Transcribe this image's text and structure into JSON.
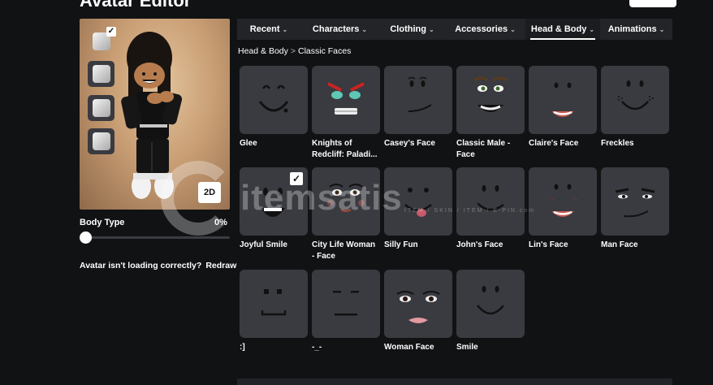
{
  "header": {
    "title": "Avatar Editor"
  },
  "preview": {
    "toggle_label": "2D"
  },
  "body_type": {
    "label": "Body Type",
    "value": "0%",
    "level": 0
  },
  "notice": {
    "text": "Avatar isn't loading correctly?",
    "link": "Redraw"
  },
  "tabs": [
    {
      "label": "Recent",
      "active": false
    },
    {
      "label": "Characters",
      "active": false
    },
    {
      "label": "Clothing",
      "active": false
    },
    {
      "label": "Accessories",
      "active": false
    },
    {
      "label": "Head & Body",
      "active": true
    },
    {
      "label": "Animations",
      "active": false
    }
  ],
  "breadcrumb": {
    "parent": "Head & Body",
    "separator": ">",
    "current": "Classic Faces"
  },
  "faces": [
    {
      "name": "Glee",
      "icon": "glee-face-icon",
      "selected": false
    },
    {
      "name": "Knights of Redcliff: Paladi...",
      "icon": "knights-of-redcliff-face-icon",
      "selected": false
    },
    {
      "name": "Casey's Face",
      "icon": "caseys-face-icon",
      "selected": false
    },
    {
      "name": "Classic Male - Face",
      "icon": "classic-male-face-icon",
      "selected": false
    },
    {
      "name": "Claire's Face",
      "icon": "claires-face-icon",
      "selected": false
    },
    {
      "name": "Freckles",
      "icon": "freckles-face-icon",
      "selected": false
    },
    {
      "name": "Joyful Smile",
      "icon": "joyful-smile-face-icon",
      "selected": true
    },
    {
      "name": "City Life Woman - Face",
      "icon": "city-life-woman-face-icon",
      "selected": false
    },
    {
      "name": "Silly Fun",
      "icon": "silly-fun-face-icon",
      "selected": false
    },
    {
      "name": "John's Face",
      "icon": "johns-face-icon",
      "selected": false
    },
    {
      "name": "Lin's Face",
      "icon": "lins-face-icon",
      "selected": false
    },
    {
      "name": "Man Face",
      "icon": "man-face-icon",
      "selected": false
    },
    {
      "name": ":]",
      "icon": "colon-bracket-face-icon",
      "selected": false
    },
    {
      "name": "-_-",
      "icon": "dash-underscore-face-icon",
      "selected": false
    },
    {
      "name": "Woman Face",
      "icon": "woman-face-icon",
      "selected": false
    },
    {
      "name": "Smile",
      "icon": "smile-face-icon",
      "selected": false
    }
  ],
  "watermark": {
    "brand": "itemsatis",
    "sub": "ITEM / SKIN / ITEM / E-PIN",
    "suffix": ".com"
  },
  "colors": {
    "background": "#111214",
    "tile": "#393b40",
    "tab_bar": "#232428",
    "accent": "#ffffff"
  }
}
